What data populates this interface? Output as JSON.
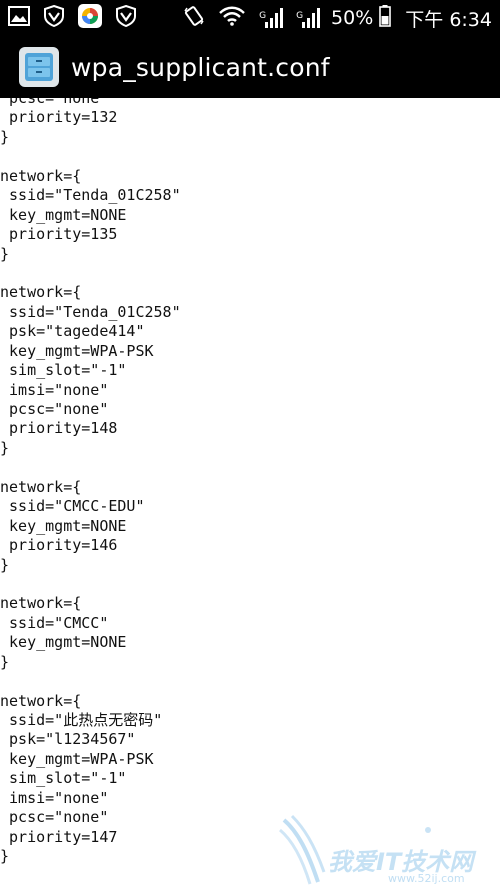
{
  "status_bar": {
    "battery_percent": "50%",
    "time": "下午 6:34",
    "signal_1_label": "G",
    "signal_2_label": "G",
    "icons": [
      "image-icon",
      "shield-icon",
      "app-store-icon",
      "shield-icon",
      "rotate-icon",
      "wifi-icon",
      "signal-icon",
      "signal-icon",
      "battery-icon"
    ]
  },
  "action_bar": {
    "title": "wpa_supplicant.conf",
    "icon": "file-manager-icon"
  },
  "file_content": {
    "lines": [
      " pcsc=\"none\"",
      " priority=132",
      "}",
      "",
      "network={",
      " ssid=\"Tenda_01C258\"",
      " key_mgmt=NONE",
      " priority=135",
      "}",
      "",
      "network={",
      " ssid=\"Tenda_01C258\"",
      " psk=\"tagede414\"",
      " key_mgmt=WPA-PSK",
      " sim_slot=\"-1\"",
      " imsi=\"none\"",
      " pcsc=\"none\"",
      " priority=148",
      "}",
      "",
      "network={",
      " ssid=\"CMCC-EDU\"",
      " key_mgmt=NONE",
      " priority=146",
      "}",
      "",
      "network={",
      " ssid=\"CMCC\"",
      " key_mgmt=NONE",
      "}",
      "",
      "network={",
      " ssid=\"此热点无密码\"",
      " psk=\"l1234567\"",
      " key_mgmt=WPA-PSK",
      " sim_slot=\"-1\"",
      " imsi=\"none\"",
      " pcsc=\"none\"",
      " priority=147",
      "}"
    ]
  },
  "watermark": {
    "text": "我爱IT技术网",
    "url": "www.52ij.com"
  }
}
